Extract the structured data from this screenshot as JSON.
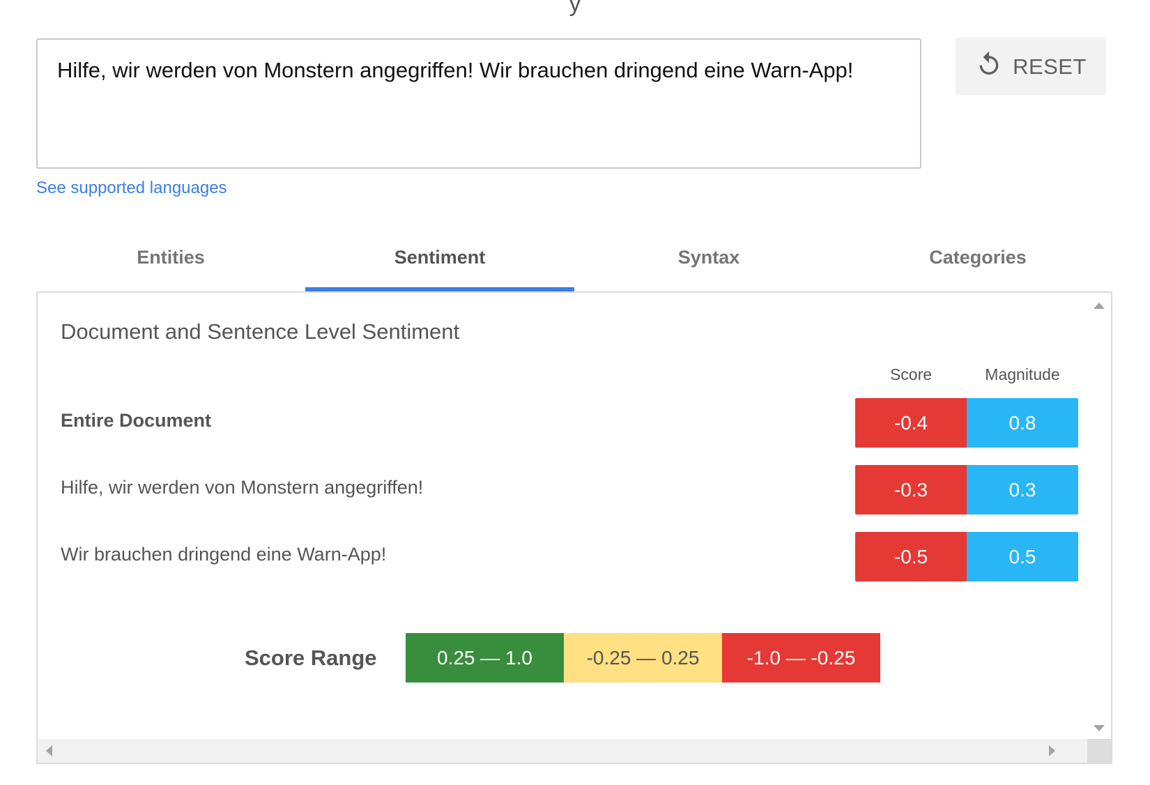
{
  "input": {
    "text": "Hilfe, wir werden von Monstern angegriffen! Wir brauchen dringend eine Warn-App!"
  },
  "reset_button": {
    "label": "RESET",
    "icon": "reset-icon"
  },
  "supported_languages_link": "See supported languages",
  "tabs": [
    {
      "label": "Entities",
      "active": false
    },
    {
      "label": "Sentiment",
      "active": true
    },
    {
      "label": "Syntax",
      "active": false
    },
    {
      "label": "Categories",
      "active": false
    }
  ],
  "sentiment": {
    "title": "Document and Sentence Level Sentiment",
    "headers": {
      "score": "Score",
      "magnitude": "Magnitude"
    },
    "rows": [
      {
        "label": "Entire Document",
        "score": "-0.4",
        "magnitude": "0.8"
      },
      {
        "label": "Hilfe, wir werden von Monstern angegriffen!",
        "score": "-0.3",
        "magnitude": "0.3"
      },
      {
        "label": "Wir brauchen dringend eine Warn-App!",
        "score": "-0.5",
        "magnitude": "0.5"
      }
    ],
    "score_range": {
      "label": "Score Range",
      "ranges": [
        {
          "text": "0.25 — 1.0",
          "color": "#388e3c"
        },
        {
          "text": "-0.25 — 0.25",
          "color": "#ffe082"
        },
        {
          "text": "-1.0 — -0.25",
          "color": "#e53935"
        }
      ]
    }
  },
  "colors": {
    "negative": "#e53935",
    "magnitude": "#29b6f6",
    "accent": "#3d7ee6"
  }
}
